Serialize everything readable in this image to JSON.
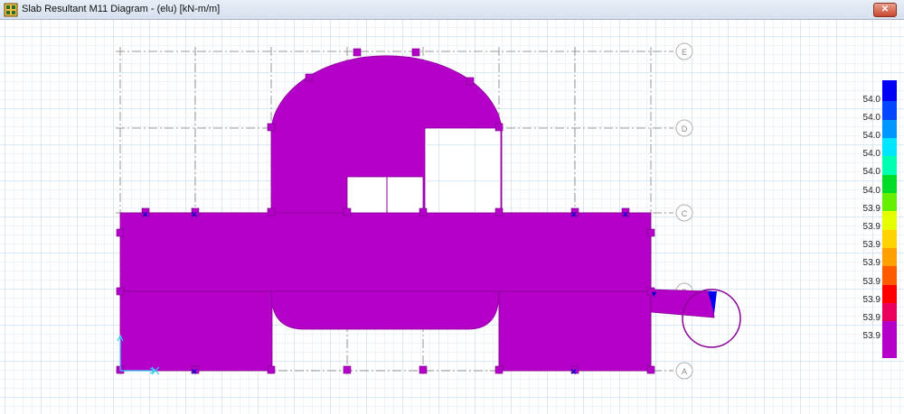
{
  "window": {
    "title": "Slab Resultant M11 Diagram - (elu)  [kN-m/m]",
    "close_glyph": "✕"
  },
  "grid_labels": {
    "E": "E",
    "D": "D",
    "C": "C",
    "B": "B",
    "A": "A"
  },
  "legend": {
    "labels": [
      "54.0",
      "54.0",
      "54.0",
      "54.0",
      "54.0",
      "54.0",
      "53.9",
      "53.9",
      "53.9",
      "53.9",
      "53.9",
      "53.9",
      "53.9",
      "53.9"
    ],
    "colors": [
      "#0000f5",
      "#0046ff",
      "#0096ff",
      "#00e6ff",
      "#00ffb0",
      "#00dc28",
      "#64f000",
      "#e6ff00",
      "#ffd200",
      "#ffa000",
      "#ff5a00",
      "#ff0000",
      "#e8005c",
      "#b400c8"
    ]
  },
  "colors": {
    "slab": "#b400c8",
    "grid": "#c8dcec",
    "gridline": "#a0a0a0",
    "bubble": "#b4b4b4",
    "point": "#0000c8"
  }
}
